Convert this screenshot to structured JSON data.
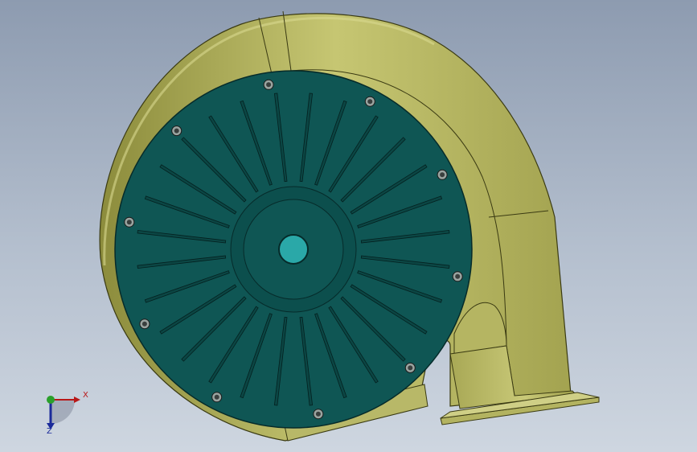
{
  "viewport": {
    "background_top": "#8d9bb0",
    "background_bottom": "#ced6e0"
  },
  "model": {
    "housing_color": "#c0c06a",
    "cover_color": "#0f5654",
    "fin_color": "#0b4644",
    "hub_color": "#2aa8a8",
    "bolt_count": 10,
    "fin_count": 28
  },
  "triad": {
    "x_label": "X",
    "z_label": "Z",
    "x_color": "#b81818",
    "y_color": "#2aa02a",
    "z_color": "#1a2a9a"
  }
}
